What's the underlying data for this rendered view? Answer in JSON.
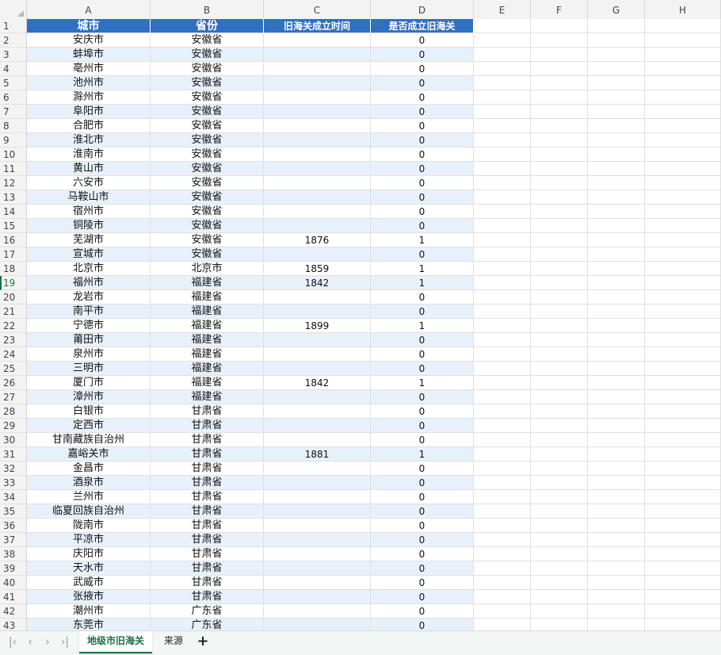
{
  "columns": [
    "A",
    "B",
    "C",
    "D",
    "E",
    "F",
    "G",
    "H"
  ],
  "header_row": {
    "num": "1",
    "cells": [
      "城市",
      "省份",
      "旧海关成立时间",
      "是否成立旧海关"
    ]
  },
  "rows": [
    {
      "num": "2",
      "cells": [
        "安庆市",
        "安徽省",
        "",
        "0"
      ]
    },
    {
      "num": "3",
      "cells": [
        "蚌埠市",
        "安徽省",
        "",
        "0"
      ]
    },
    {
      "num": "4",
      "cells": [
        "亳州市",
        "安徽省",
        "",
        "0"
      ]
    },
    {
      "num": "5",
      "cells": [
        "池州市",
        "安徽省",
        "",
        "0"
      ]
    },
    {
      "num": "6",
      "cells": [
        "滁州市",
        "安徽省",
        "",
        "0"
      ]
    },
    {
      "num": "7",
      "cells": [
        "阜阳市",
        "安徽省",
        "",
        "0"
      ]
    },
    {
      "num": "8",
      "cells": [
        "合肥市",
        "安徽省",
        "",
        "0"
      ]
    },
    {
      "num": "9",
      "cells": [
        "淮北市",
        "安徽省",
        "",
        "0"
      ]
    },
    {
      "num": "10",
      "cells": [
        "淮南市",
        "安徽省",
        "",
        "0"
      ]
    },
    {
      "num": "11",
      "cells": [
        "黄山市",
        "安徽省",
        "",
        "0"
      ]
    },
    {
      "num": "12",
      "cells": [
        "六安市",
        "安徽省",
        "",
        "0"
      ]
    },
    {
      "num": "13",
      "cells": [
        "马鞍山市",
        "安徽省",
        "",
        "0"
      ]
    },
    {
      "num": "14",
      "cells": [
        "宿州市",
        "安徽省",
        "",
        "0"
      ]
    },
    {
      "num": "15",
      "cells": [
        "铜陵市",
        "安徽省",
        "",
        "0"
      ]
    },
    {
      "num": "16",
      "cells": [
        "芜湖市",
        "安徽省",
        "1876",
        "1"
      ]
    },
    {
      "num": "17",
      "cells": [
        "宣城市",
        "安徽省",
        "",
        "0"
      ]
    },
    {
      "num": "18",
      "cells": [
        "北京市",
        "北京市",
        "1859",
        "1"
      ]
    },
    {
      "num": "19",
      "cells": [
        "福州市",
        "福建省",
        "1842",
        "1"
      ]
    },
    {
      "num": "20",
      "cells": [
        "龙岩市",
        "福建省",
        "",
        "0"
      ]
    },
    {
      "num": "21",
      "cells": [
        "南平市",
        "福建省",
        "",
        "0"
      ]
    },
    {
      "num": "22",
      "cells": [
        "宁德市",
        "福建省",
        "1899",
        "1"
      ]
    },
    {
      "num": "23",
      "cells": [
        "莆田市",
        "福建省",
        "",
        "0"
      ]
    },
    {
      "num": "24",
      "cells": [
        "泉州市",
        "福建省",
        "",
        "0"
      ]
    },
    {
      "num": "25",
      "cells": [
        "三明市",
        "福建省",
        "",
        "0"
      ]
    },
    {
      "num": "26",
      "cells": [
        "厦门市",
        "福建省",
        "1842",
        "1"
      ]
    },
    {
      "num": "27",
      "cells": [
        "漳州市",
        "福建省",
        "",
        "0"
      ]
    },
    {
      "num": "28",
      "cells": [
        "白银市",
        "甘肃省",
        "",
        "0"
      ]
    },
    {
      "num": "29",
      "cells": [
        "定西市",
        "甘肃省",
        "",
        "0"
      ]
    },
    {
      "num": "30",
      "cells": [
        "甘南藏族自治州",
        "甘肃省",
        "",
        "0"
      ]
    },
    {
      "num": "31",
      "cells": [
        "嘉峪关市",
        "甘肃省",
        "1881",
        "1"
      ]
    },
    {
      "num": "32",
      "cells": [
        "金昌市",
        "甘肃省",
        "",
        "0"
      ]
    },
    {
      "num": "33",
      "cells": [
        "酒泉市",
        "甘肃省",
        "",
        "0"
      ]
    },
    {
      "num": "34",
      "cells": [
        "兰州市",
        "甘肃省",
        "",
        "0"
      ]
    },
    {
      "num": "35",
      "cells": [
        "临夏回族自治州",
        "甘肃省",
        "",
        "0"
      ]
    },
    {
      "num": "36",
      "cells": [
        "陇南市",
        "甘肃省",
        "",
        "0"
      ]
    },
    {
      "num": "37",
      "cells": [
        "平凉市",
        "甘肃省",
        "",
        "0"
      ]
    },
    {
      "num": "38",
      "cells": [
        "庆阳市",
        "甘肃省",
        "",
        "0"
      ]
    },
    {
      "num": "39",
      "cells": [
        "天水市",
        "甘肃省",
        "",
        "0"
      ]
    },
    {
      "num": "40",
      "cells": [
        "武威市",
        "甘肃省",
        "",
        "0"
      ]
    },
    {
      "num": "41",
      "cells": [
        "张掖市",
        "甘肃省",
        "",
        "0"
      ]
    },
    {
      "num": "42",
      "cells": [
        "潮州市",
        "广东省",
        "",
        "0"
      ]
    },
    {
      "num": "43",
      "cells": [
        "东莞市",
        "广东省",
        "",
        "0"
      ]
    }
  ],
  "active_row": "19",
  "sheet_tabs": [
    {
      "label": "地级市旧海关",
      "active": true
    },
    {
      "label": "来源",
      "active": false
    }
  ],
  "nav_icons": [
    "first-sheet-icon",
    "prev-sheet-icon",
    "next-sheet-icon",
    "last-sheet-icon"
  ],
  "add_sheet_icon": "plus-icon",
  "colors": {
    "header_fill": "#2f70c0",
    "band_fill": "#e8f1fb",
    "accent": "#1e7145"
  }
}
